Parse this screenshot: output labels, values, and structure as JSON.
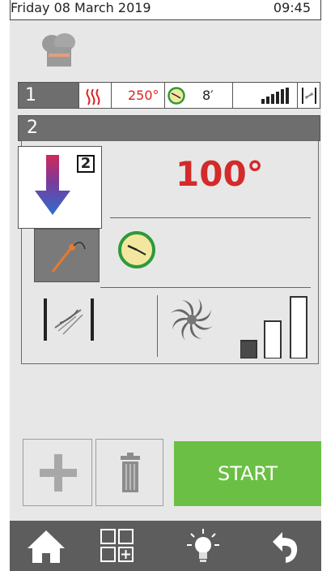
{
  "status": {
    "date": "Friday 08 March 2019",
    "time": "09:45"
  },
  "step1": {
    "number": "1",
    "temperature": "250°",
    "duration": "8′"
  },
  "step2": {
    "number": "2",
    "phase_badge": "2",
    "target_temperature": "100°"
  },
  "actions": {
    "start_label": "START"
  },
  "colors": {
    "accent_green": "#6abf44",
    "temp_red": "#d32a2a",
    "nav_bg": "#5d5d5d",
    "step_header": "#6e6e6e"
  },
  "icons": {
    "chef": "chef-hat-icon",
    "heat": "heat-waves-icon",
    "clock": "clock-icon",
    "fan_speed": "fan-speed-bars-icon",
    "vent": "vent-valve-icon",
    "probe": "core-probe-icon",
    "fan": "fan-icon",
    "add": "plus-icon",
    "delete": "trash-icon",
    "home": "home-icon",
    "grid": "grid-add-icon",
    "light": "light-icon",
    "back": "back-arrow-icon"
  }
}
